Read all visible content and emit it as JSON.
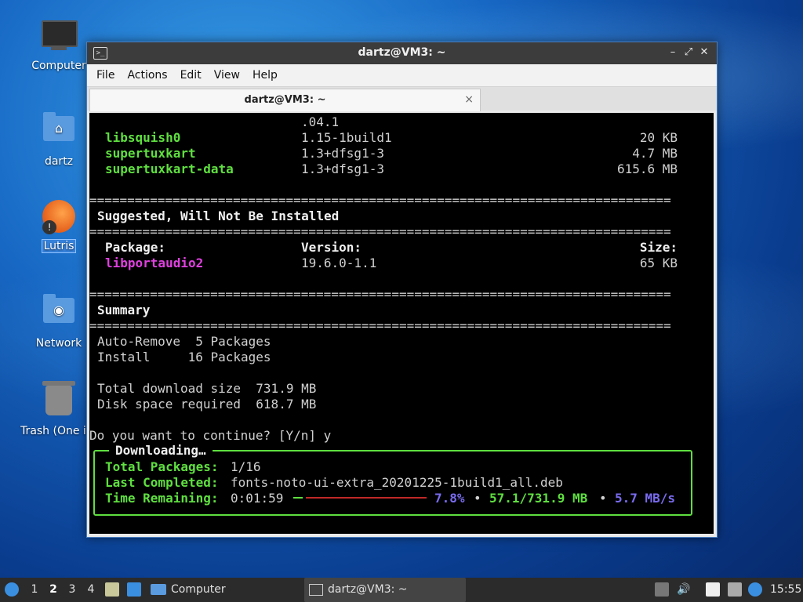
{
  "desktop": {
    "icons": [
      {
        "label": "Computer"
      },
      {
        "label": "dartz"
      },
      {
        "label": "Lutris"
      },
      {
        "label": "Network"
      },
      {
        "label": "Trash (One ite"
      }
    ]
  },
  "window": {
    "title": "dartz@VM3: ~",
    "menu": [
      "File",
      "Actions",
      "Edit",
      "View",
      "Help"
    ],
    "tab_title": "dartz@VM3: ~",
    "tab_close": "×"
  },
  "terminal": {
    "top_fragment": ".04.1",
    "packages_above": [
      {
        "name": "libsquish0",
        "version": "1.15-1build1",
        "size": "20 KB"
      },
      {
        "name": "supertuxkart",
        "version": "1.3+dfsg1-3",
        "size": "4.7 MB"
      },
      {
        "name": "supertuxkart-data",
        "version": "1.3+dfsg1-3",
        "size": "615.6 MB"
      }
    ],
    "rule": "=============================================================================",
    "suggested_header": "Suggested, Will Not Be Installed",
    "col_package": "Package:",
    "col_version": "Version:",
    "col_size": "Size:",
    "suggested_pkg": {
      "name": "libportaudio2",
      "version": "19.6.0-1.1",
      "size": "65 KB"
    },
    "summary_header": "Summary",
    "auto_remove": "Auto-Remove  5 Packages",
    "install": "Install     16 Packages",
    "download_size": "Total download size  731.9 MB",
    "disk_space": "Disk space required  618.7 MB",
    "prompt": "Do you want to continue? [Y/n] y",
    "download": {
      "title": "Downloading…",
      "total_label": "Total Packages:",
      "total_value": "1/16",
      "last_label": "Last Completed:",
      "last_value": "fonts-noto-ui-extra_20201225-1build1_all.deb",
      "time_label": "Time Remaining:",
      "time_value": "0:01:59",
      "percent": "7.8%",
      "progress_fraction": 0.078,
      "bytes": "57.1/731.9 MB",
      "speed": "5.7 MB/s",
      "bullet": "•"
    }
  },
  "taskbar": {
    "workspaces": [
      "1",
      "2",
      "3",
      "4"
    ],
    "active_workspace": "2",
    "computer_task": "Computer",
    "terminal_task": "dartz@VM3: ~",
    "clock": "15:55"
  }
}
